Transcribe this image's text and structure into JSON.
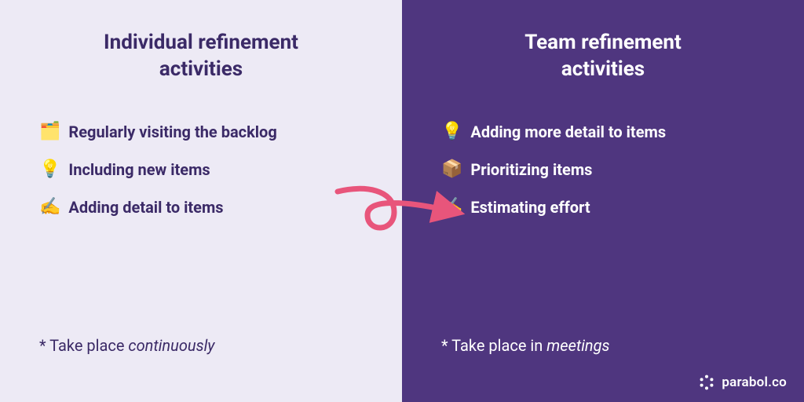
{
  "left": {
    "heading_l1": "Individual refinement",
    "heading_l2": "activities",
    "items": [
      {
        "emoji": "🗂️",
        "label": "Regularly visiting the backlog"
      },
      {
        "emoji": "💡",
        "label": "Including new items"
      },
      {
        "emoji": "✍️",
        "label": "Adding detail to items"
      }
    ],
    "footnote_prefix": "* Take place ",
    "footnote_em": "continuously"
  },
  "right": {
    "heading_l1": "Team refinement",
    "heading_l2": "activities",
    "items": [
      {
        "emoji": "💡",
        "label": "Adding more detail to items"
      },
      {
        "emoji": "📦",
        "label": "Prioritizing items"
      },
      {
        "emoji": "✍️",
        "label": "Estimating effort"
      }
    ],
    "footnote_prefix": "* Take place in ",
    "footnote_em": "meetings"
  },
  "brand": {
    "name": "parabol.co"
  },
  "colors": {
    "arrow": "#E8557B"
  }
}
